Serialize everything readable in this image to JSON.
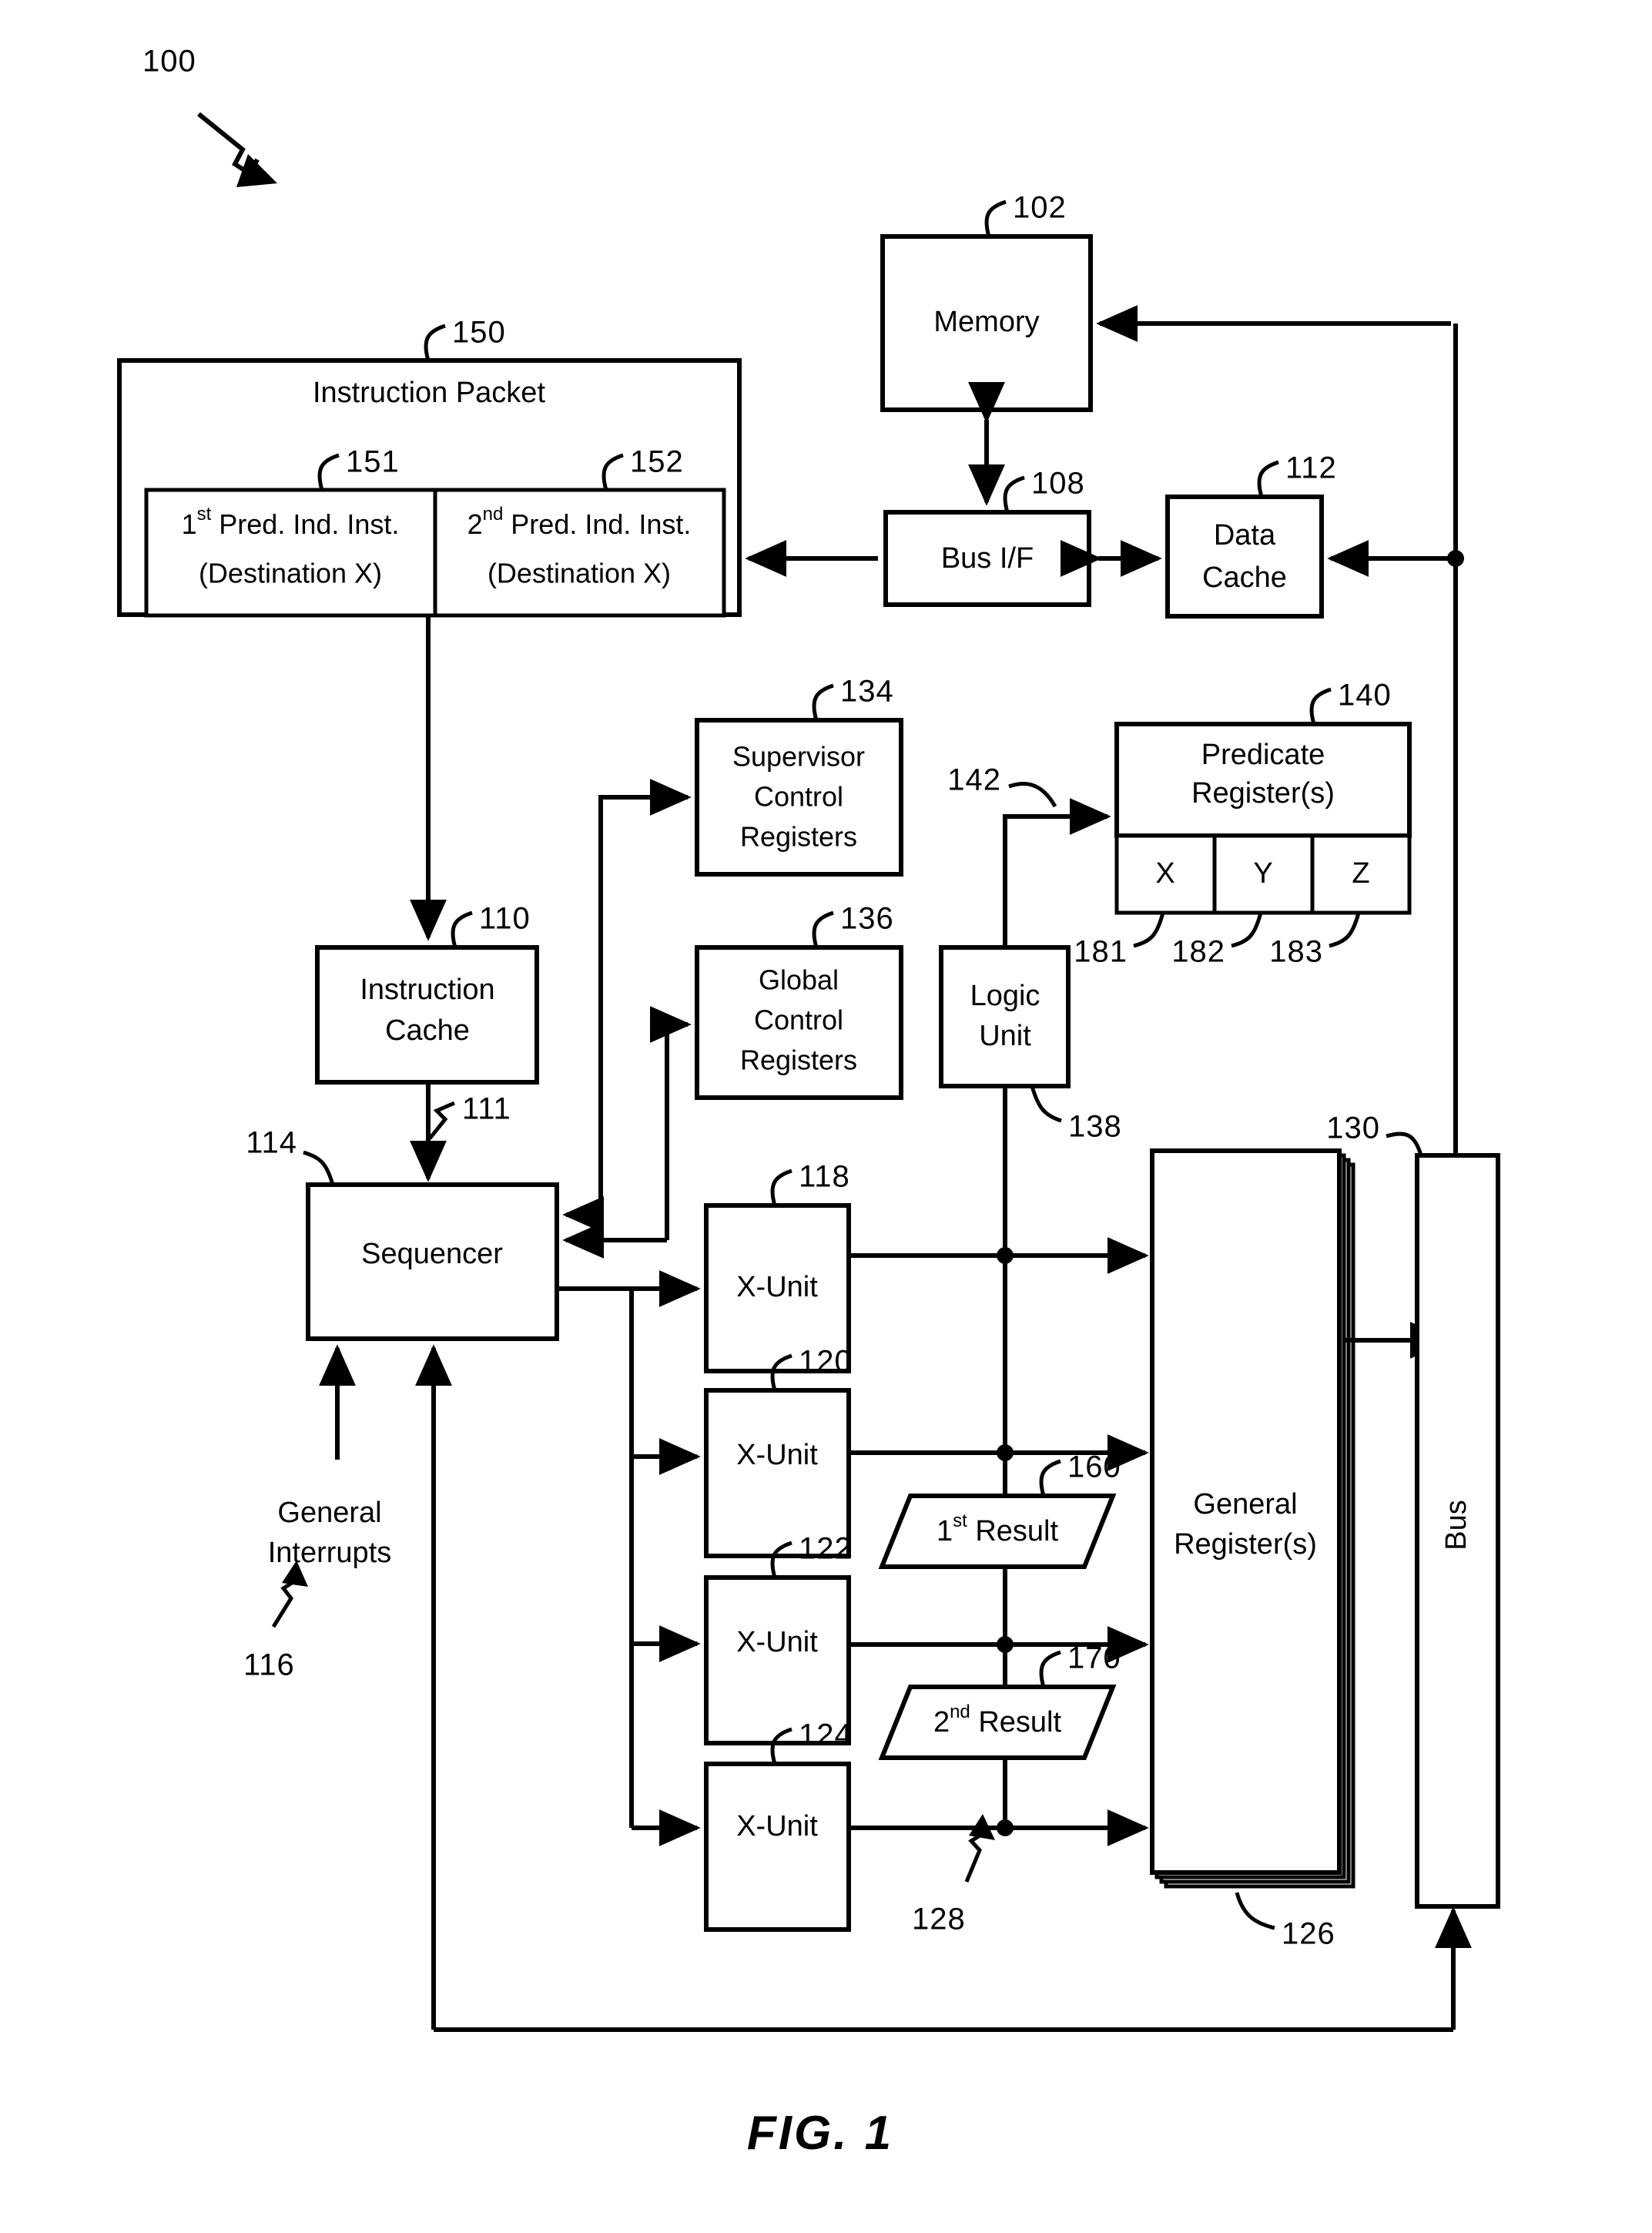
{
  "figure": {
    "caption": "FIG. 1",
    "system_ref": "100"
  },
  "blocks": {
    "instruction_packet": {
      "label": "Instruction Packet",
      "ref": "150"
    },
    "first_instruction": {
      "line1_prefix": "1",
      "line1_sup": "st",
      "line1_rest": " Pred. Ind. Inst.",
      "line2": "(Destination X)",
      "ref": "151"
    },
    "second_instruction": {
      "line1_prefix": "2",
      "line1_sup": "nd",
      "line1_rest": " Pred. Ind. Inst.",
      "line2": "(Destination X)",
      "ref": "152"
    },
    "memory": {
      "label": "Memory",
      "ref": "102"
    },
    "bus_if": {
      "label": "Bus I/F",
      "ref": "108"
    },
    "data_cache": {
      "line1": "Data",
      "line2": "Cache",
      "ref": "112"
    },
    "supervisor_control_registers": {
      "line1": "Supervisor",
      "line2": "Control",
      "line3": "Registers",
      "ref": "134"
    },
    "global_control_registers": {
      "line1": "Global",
      "line2": "Control",
      "line3": "Registers",
      "ref": "136"
    },
    "predicate_registers": {
      "line1": "Predicate",
      "line2": "Register(s)",
      "ref": "140",
      "input_ref": "142"
    },
    "predicate_cells": [
      {
        "label": "X",
        "ref": "181"
      },
      {
        "label": "Y",
        "ref": "182"
      },
      {
        "label": "Z",
        "ref": "183"
      }
    ],
    "logic_unit": {
      "line1": "Logic",
      "line2": "Unit",
      "output_ref": "138"
    },
    "instruction_cache": {
      "line1": "Instruction",
      "line2": "Cache",
      "ref": "110",
      "output_ref": "111"
    },
    "sequencer": {
      "label": "Sequencer",
      "ref": "114"
    },
    "general_interrupts": {
      "line1": "General",
      "line2": "Interrupts",
      "ref": "116"
    },
    "x_units": [
      {
        "label": "X-Unit",
        "ref": "118"
      },
      {
        "label": "X-Unit",
        "ref": "120"
      },
      {
        "label": "X-Unit",
        "ref": "122"
      },
      {
        "label": "X-Unit",
        "ref": "124"
      }
    ],
    "first_result": {
      "prefix": "1",
      "sup": "st",
      "rest": " Result",
      "ref": "160"
    },
    "second_result": {
      "prefix": "2",
      "sup": "nd",
      "rest": " Result",
      "ref": "170"
    },
    "general_registers": {
      "line1": "General",
      "line2": "Register(s)",
      "ref": "126"
    },
    "bus": {
      "label": "Bus",
      "ref": "130"
    },
    "result_bus_ref": "128"
  }
}
